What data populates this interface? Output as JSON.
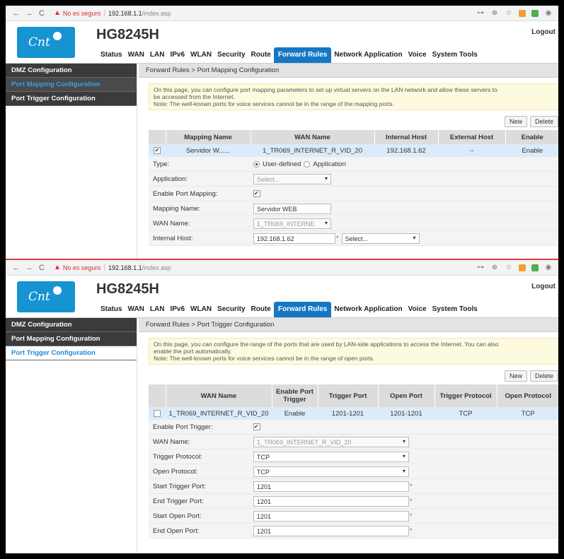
{
  "browser": {
    "back": "←",
    "forward": "→",
    "reload": "C",
    "insecure_label": "No es seguro",
    "url_host": "192.168.1.1",
    "url_path": "/index.asp"
  },
  "header": {
    "logo_text": "Cnt",
    "model": "HG8245H",
    "logout": "Logout",
    "menu": [
      "Status",
      "WAN",
      "LAN",
      "IPv6",
      "WLAN",
      "Security",
      "Route",
      "Forward Rules",
      "Network Application",
      "Voice",
      "System Tools"
    ],
    "active_menu": "Forward Rules"
  },
  "sidebar": {
    "items": [
      "DMZ Configuration",
      "Port Mapping Configuration",
      "Port Trigger Configuration"
    ]
  },
  "top": {
    "breadcrumb": "Forward Rules > Port Mapping Configuration",
    "notice_line1": "On this page, you can configure port mapping parameters to set up virtual servers on the LAN network and allow these servers to",
    "notice_line2": "be accessed from the Internet.",
    "notice_line3": "Note: The well-known ports for voice services cannot be in the range of the mapping ports.",
    "btn_new": "New",
    "btn_delete": "Delete",
    "columns": [
      "Mapping Name",
      "WAN Name",
      "Internal Host",
      "External Host",
      "Enable"
    ],
    "row": {
      "checked": "✔",
      "mapping_name": "Servidor W......",
      "wan_name": "1_TR069_INTERNET_R_VID_20",
      "internal_host": "192.168.1.62",
      "external_host": "--",
      "enable": "Enable"
    },
    "form": {
      "type_label": "Type:",
      "type_user": "User-defined",
      "type_app": "Application",
      "application_label": "Application:",
      "application_value": "Select...",
      "enable_label": "Enable Port Mapping:",
      "enable_check": "✔",
      "mapping_name_label": "Mapping Name:",
      "mapping_name_value": "Servidor WEB",
      "wan_name_label": "WAN Name:",
      "wan_name_value": "1_TR069_INTERNE",
      "internal_host_label": "Internal Host:",
      "internal_host_value": "192.168.1.62",
      "internal_host_select": "Select..."
    }
  },
  "bottom": {
    "breadcrumb": "Forward Rules > Port Trigger Configuration",
    "notice_line1": "On this page, you can configure the range of the ports that are used by LAN-side applications to access the Internet. You can also",
    "notice_line2": "enable the port automatically.",
    "notice_line3": "Note: The well-known ports for voice services cannot be in the range of open ports.",
    "btn_new": "New",
    "btn_delete": "Delete",
    "columns": [
      "WAN Name",
      "Enable Port Trigger",
      "Trigger Port",
      "Open Port",
      "Trigger Protocol",
      "Open Protocol"
    ],
    "row": {
      "wan_name": "1_TR069_INTERNET_R_VID_20",
      "enable": "Enable",
      "trigger_port": "1201-1201",
      "open_port": "1201-1201",
      "trigger_protocol": "TCP",
      "open_protocol": "TCP"
    },
    "form": {
      "enable_label": "Enable Port Trigger:",
      "enable_check": "✔",
      "wan_name_label": "WAN Name:",
      "wan_name_value": "1_TR069_INTERNET_R_VID_20",
      "trigger_protocol_label": "Trigger Protocol:",
      "trigger_protocol_value": "TCP",
      "open_protocol_label": "Open Protocol:",
      "open_protocol_value": "TCP",
      "start_trigger_label": "Start Trigger Port:",
      "start_trigger_value": "1201",
      "end_trigger_label": "End Trigger Port:",
      "end_trigger_value": "1201",
      "start_open_label": "Start Open Port:",
      "start_open_value": "1201",
      "end_open_label": "End Open Port:",
      "end_open_value": "1201"
    }
  },
  "colors": {
    "accent": "#1577c4",
    "logo": "#1793d1",
    "sidebar": "#3b3b3b",
    "notice": "#fdfae0",
    "row": "#dcebfa",
    "divider": "#e23c3c"
  }
}
